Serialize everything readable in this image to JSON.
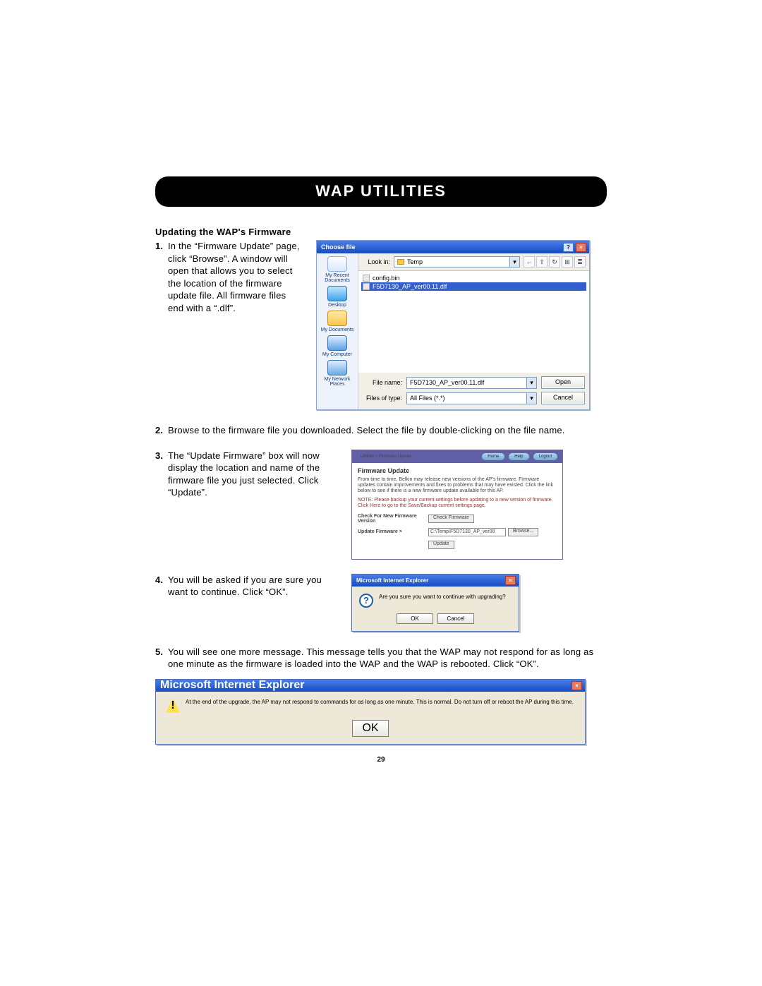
{
  "banner": "Wap Utilities",
  "section_title": "Updating the WAP's Firmware",
  "steps": {
    "s1_num": "1.",
    "s1": "In the “Firmware Update” page, click “Browse”. A window will open that allows you to select the location of the firmware update file. All firmware files end with a “.dlf”.",
    "s2_num": "2.",
    "s2": "Browse to the firmware file you downloaded. Select the file by double-clicking on the file name.",
    "s3_num": "3.",
    "s3": "The “Update Firmware” box will now display the location and name of the firmware file you just selected. Click “Update”.",
    "s4_num": "4.",
    "s4": "You will be asked if you are sure you want to continue. Click “OK”.",
    "s5_num": "5.",
    "s5": "You will see one more message. This message tells you that the WAP may not respond for as long as one minute as the firmware is loaded into the WAP and the WAP is rebooted. Click “OK”."
  },
  "choose_file": {
    "title": "Choose file",
    "lookin_label": "Look in:",
    "lookin_value": "Temp",
    "toolbar_icons": [
      "←",
      "⇧",
      "↻",
      "⊞",
      "≣"
    ],
    "places": {
      "recent": "My Recent Documents",
      "desktop": "Desktop",
      "docs": "My Documents",
      "computer": "My Computer",
      "network": "My Network Places"
    },
    "files": {
      "f1": "config.bin",
      "f2": "F5D7130_AP_ver00.11.dlf"
    },
    "filename_label": "File name:",
    "filename_value": "F5D7130_AP_ver00.11.dlf",
    "filetype_label": "Files of type:",
    "filetype_value": "All Files (*.*)",
    "open": "Open",
    "cancel": "Cancel",
    "help_btn": "?",
    "close_btn": "×"
  },
  "firmware_update": {
    "breadcrumb": "Utilities > Firmware Update",
    "tabs": {
      "home": "Home",
      "help": "Help",
      "logout": "Logout"
    },
    "heading": "Firmware Update",
    "para1": "From time to time, Belkin may release new versions of the AP's firmware. Firmware updates contain improvements and fixes to problems that may have existed. Click the link below to see if there is a new firmware update available for this AP.",
    "para2": "NOTE: Please backup your current settings before updating to a new version of firmware. Click Here to go to the Save/Backup current settings page.",
    "check_label": "Check For New Firmware Version",
    "check_btn": "Check Firmware",
    "update_label": "Update Firmware >",
    "update_value": "C:\\Temp\\F5D7130_AP_ver00",
    "browse_btn": "Browse...",
    "update_btn": "Update"
  },
  "confirm_dialog": {
    "title": "Microsoft Internet Explorer",
    "msg": "Are you sure you want to continue with upgrading?",
    "ok": "OK",
    "cancel": "Cancel",
    "close": "×"
  },
  "final_dialog": {
    "title": "Microsoft Internet Explorer",
    "msg": "At the end of the upgrade, the AP may not respond to commands for as long as one minute. This is normal. Do not turn off or reboot the AP during this time.",
    "ok": "OK",
    "close": "×"
  },
  "page_number": "29"
}
